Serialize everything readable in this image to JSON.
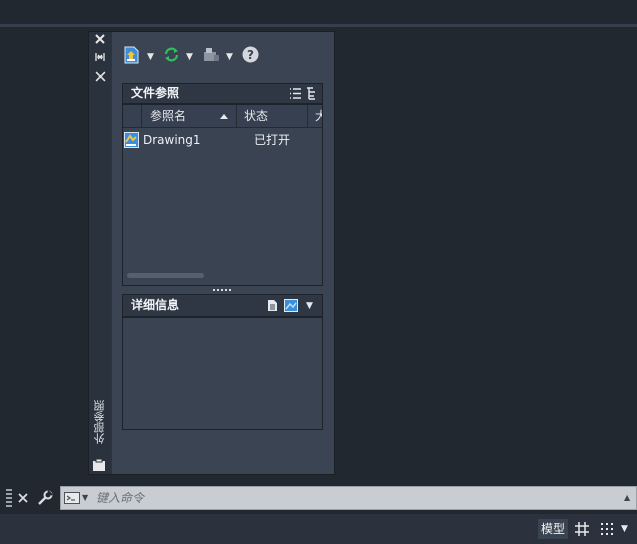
{
  "palette": {
    "vertical_title": "外部参照"
  },
  "file_refs": {
    "header": "文件参照",
    "columns": [
      "参照名",
      "状态",
      "大"
    ],
    "rows": [
      {
        "name": "Drawing1",
        "status": "已打开"
      }
    ]
  },
  "details": {
    "header": "详细信息"
  },
  "command_line": {
    "placeholder": "键入命令"
  },
  "status_bar": {
    "model_label": "模型"
  },
  "icons": {
    "close": "close-icon",
    "autohide": "autohide-icon",
    "properties": "properties-icon",
    "attach": "attach-dwg-icon",
    "refresh": "refresh-icon",
    "change_path": "change-path-icon",
    "help": "help-icon",
    "list_view": "list-view-icon",
    "tree_view": "tree-view-icon"
  },
  "colors": {
    "background": "#212830",
    "palette_body": "#3b4453",
    "refresh_green": "#2fbf5b",
    "accent_blue": "#3a8fd8"
  }
}
